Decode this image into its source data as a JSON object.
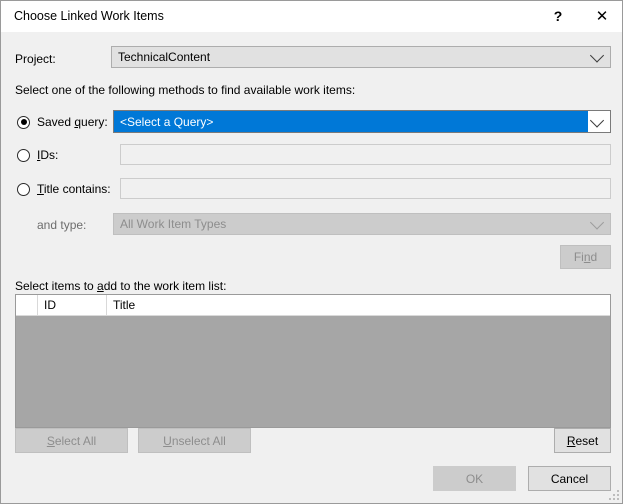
{
  "window": {
    "title": "Choose Linked Work Items",
    "help_glyph": "?",
    "close_glyph": "✕"
  },
  "project": {
    "label_pre": "Pro",
    "label_acc": "j",
    "label_post": "ect:",
    "value": "TechnicalContent"
  },
  "instruction": "Select one of the following methods to find available work items:",
  "methods": {
    "saved_query": {
      "label_pre": "Saved ",
      "label_acc": "q",
      "label_post": "uery:",
      "selected": true,
      "value": "<Select a Query>"
    },
    "ids": {
      "label_pre": "",
      "label_acc": "I",
      "label_post": "Ds:",
      "selected": false,
      "value": "",
      "placeholder": ""
    },
    "title_contains": {
      "label_pre": "",
      "label_acc": "T",
      "label_post": "itle contains:",
      "selected": false,
      "value": "",
      "placeholder": ""
    },
    "and_type": {
      "label": "and type:",
      "value": "All Work Item Types",
      "enabled": false
    },
    "find": {
      "label_pre": "Fi",
      "label_acc": "n",
      "label_post": "d",
      "enabled": false
    }
  },
  "list": {
    "caption_pre": "Select items to ",
    "caption_acc": "a",
    "caption_post": "dd to the work item list:",
    "columns": [
      "",
      "ID",
      "Title"
    ],
    "rows": []
  },
  "actions": {
    "select_all": {
      "label_pre": "",
      "label_acc": "S",
      "label_post": "elect All",
      "enabled": false
    },
    "unselect_all": {
      "label_pre": "",
      "label_acc": "U",
      "label_post": "nselect All",
      "enabled": false
    },
    "reset": {
      "label_pre": "",
      "label_acc": "R",
      "label_post": "eset",
      "enabled": true
    },
    "ok": {
      "label": "OK",
      "enabled": false
    },
    "cancel": {
      "label": "Cancel",
      "enabled": true
    }
  },
  "colors": {
    "dialog_bg": "#f0f0f0",
    "titlebar_bg": "#ffffff",
    "selection_blue": "#0078d7",
    "list_body_gray": "#a6a6a6",
    "disabled_text": "#8d8d8d",
    "control_bg": "#e1e1e1"
  }
}
